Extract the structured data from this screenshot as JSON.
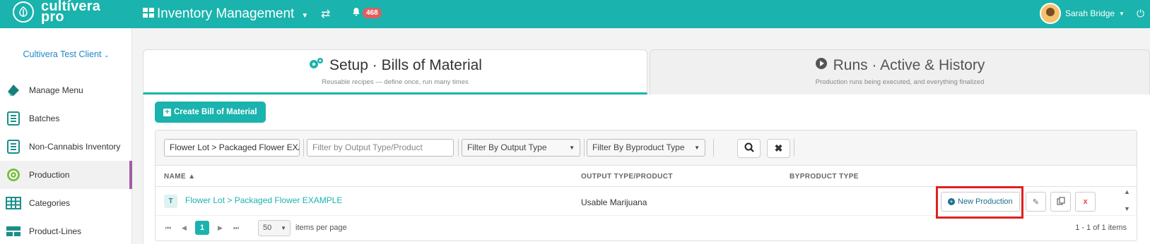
{
  "brand": {
    "name_line1": "cultívera",
    "name_line2": "pro"
  },
  "header": {
    "app_name": "Inventory Management",
    "notification_count": "468",
    "user_name": "Sarah Bridge"
  },
  "sidebar": {
    "client": "Cultivera Test Client",
    "items": [
      {
        "label": "Manage Menu",
        "icon": "tag-icon"
      },
      {
        "label": "Batches",
        "icon": "document-icon"
      },
      {
        "label": "Non-Cannabis Inventory",
        "icon": "document-icon"
      },
      {
        "label": "Production",
        "icon": "production-icon",
        "active": true
      },
      {
        "label": "Categories",
        "icon": "grid-icon"
      },
      {
        "label": "Product-Lines",
        "icon": "product-lines-icon"
      }
    ]
  },
  "tabs": [
    {
      "title": "Setup · Bills of Material",
      "subtitle": "Reusable recipes — define once, run many times",
      "active": true
    },
    {
      "title": "Runs · Active & History",
      "subtitle": "Production runs being executed, and everything finalized",
      "active": false
    }
  ],
  "actions": {
    "create_label": "Create Bill of Material"
  },
  "filters": {
    "name_value": "Flower Lot > Packaged Flower EXAI",
    "output_placeholder": "Filter by Output Type/Product",
    "output_type_select": "Filter By Output Type",
    "byproduct_type_select": "Filter By Byproduct Type"
  },
  "table": {
    "columns": [
      "NAME ▲",
      "OUTPUT TYPE/PRODUCT",
      "BYPRODUCT TYPE"
    ],
    "rows": [
      {
        "badge": "T",
        "name": "Flower Lot > Packaged Flower EXAMPLE",
        "output": "Usable Marijuana",
        "byproduct": "",
        "action_label": "New Production",
        "delete_label": "x"
      }
    ]
  },
  "pager": {
    "current_page": "1",
    "page_size": "50",
    "items_per_page_label": "items per page",
    "count_text": "1 - 1 of 1 items"
  },
  "colors": {
    "accent": "#1ab3ad",
    "active_marker": "#a55ca5",
    "highlight": "#e02020",
    "badge": "#e05e5e"
  }
}
